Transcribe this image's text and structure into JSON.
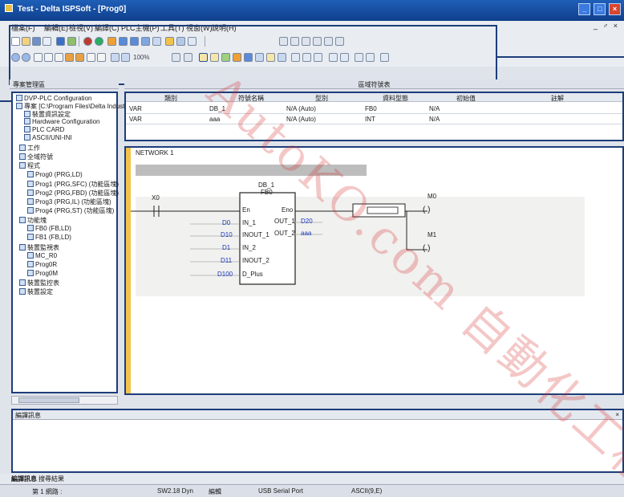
{
  "window": {
    "title": "Test - Delta ISPSoft - [Prog0]",
    "buttons": [
      "_",
      "□",
      "×"
    ]
  },
  "menubar": {
    "items": [
      "檔案(F)",
      "編輯(E)",
      "檢視(V)",
      "編譯(C)",
      "PLC主機(P)",
      "工具(T)",
      "視窗(W)",
      "說明(H)"
    ],
    "mdi_buttons": "_ ♂ ×"
  },
  "toolbar": {
    "zoom": "100%"
  },
  "panels": {
    "project_header": "專案管理區",
    "variable_header": "區域符號表"
  },
  "tree": {
    "items": [
      "DVP-PLC Configuration",
      "專案 [C:\\Program Files\\Delta Industrial",
      "裝置資訊設定",
      "Hardware Configuration",
      "PLC CARD",
      "ASCII/UNI-INI",
      "工作",
      "全域符號",
      "程式",
      "Prog0 (PRG,LD)",
      "Prog1 (PRG,SFC) (功能區塊)",
      "Prog2 (PRG,FBD) (功能區塊)",
      "Prog3 (PRG,IL) (功能區塊)",
      "Prog4 (PRG,ST) (功能區塊)",
      "功能塊",
      "FB0 (FB,LD)",
      "FB1 (FB,LD)",
      "裝置監視表",
      "MC_R0",
      "Prog0R",
      "Prog0M",
      "裝置監控表",
      "裝置設定"
    ]
  },
  "variable_table": {
    "headers": [
      "類別",
      "符號名稱",
      "型別",
      "資料型態",
      "初始值",
      "註解"
    ],
    "rows": [
      [
        "VAR",
        "DB_1",
        "N/A (Auto)",
        "FB0",
        "N/A",
        ""
      ],
      [
        "VAR",
        "aaa",
        "N/A (Auto)",
        "INT",
        "N/A",
        ""
      ]
    ]
  },
  "ladder": {
    "network_title": "NETWORK 1",
    "block_instance": "DB_1",
    "block_type": "FB0",
    "contact": "X0",
    "inputs": [
      {
        "pin": "IN_1",
        "device": "D0"
      },
      {
        "pin": "INOUT_1",
        "device": "D10"
      },
      {
        "pin": "IN_2",
        "device": "D1"
      },
      {
        "pin": "INOUT_2",
        "device": "D11"
      },
      {
        "pin": "D_Plus",
        "device": "D100"
      }
    ],
    "en": "En",
    "eno": "Eno",
    "outputs": [
      {
        "pin": "OUT_1",
        "device": "D20"
      },
      {
        "pin": "OUT_2",
        "device": "aaa"
      }
    ],
    "coils": [
      "M0",
      "M1"
    ]
  },
  "message_panel": {
    "title": "編譯訊息"
  },
  "bottom_tabs": [
    "編譯訊息",
    "搜尋結果"
  ],
  "status": {
    "row": "第 1 網路 :",
    "mode": "SW2.18 Dyn",
    "state": "編輯",
    "comm": "USB Serial Port",
    "pos": "ASCII(9,E)"
  },
  "watermark": "AutoKO.com 自動化工程"
}
